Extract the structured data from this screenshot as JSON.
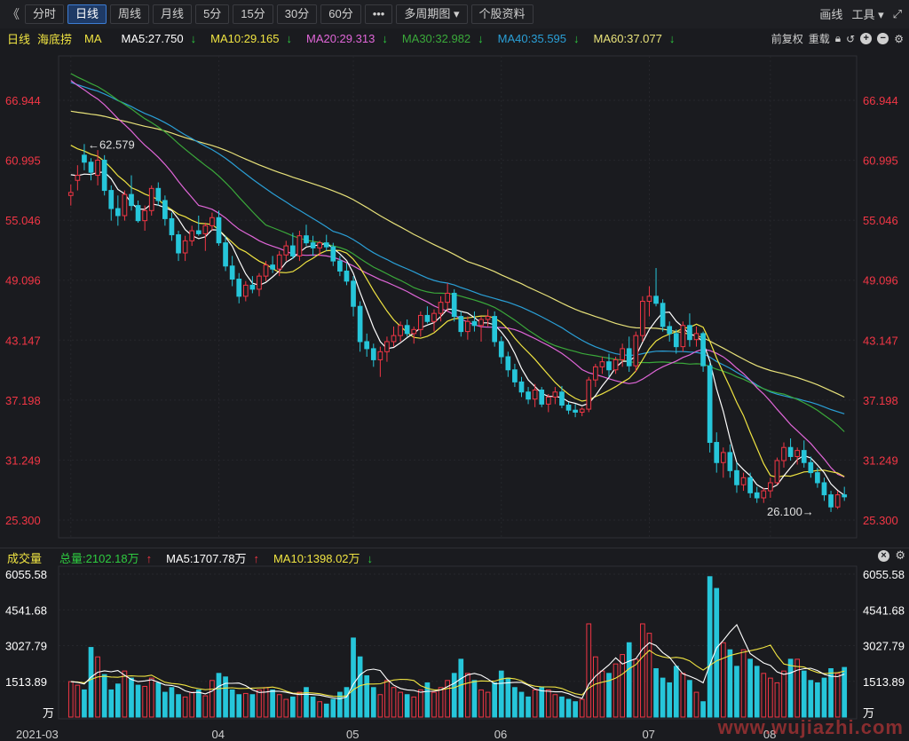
{
  "toolbar": {
    "collapse_icon": "《",
    "buttons": [
      "分时",
      "日线",
      "周线",
      "月线",
      "5分",
      "15分",
      "30分",
      "60分",
      "•••",
      "多周期图 ▾",
      "个股资料"
    ],
    "active_index": 1,
    "right": {
      "draw_label": "画线",
      "tools_label": "工具",
      "fullscreen_icon": "expand-icon"
    }
  },
  "ma_bar": {
    "period": "日线",
    "stock_name": "海底捞",
    "indicator": "MA",
    "ma5": "MA5:27.750",
    "ma10": "MA10:29.165",
    "ma20": "MA20:29.313",
    "ma30": "MA30:32.982",
    "ma40": "MA40:35.595",
    "ma60": "MA60:37.077",
    "down_arrow": "↓",
    "adjust_label": "前复权",
    "reset_label": "重载"
  },
  "volume_bar": {
    "title": "成交量",
    "total": "总量:2102.18万",
    "ma5": "MA5:1707.78万",
    "ma10": "MA10:1398.02万",
    "up_arrow": "↑",
    "down_arrow": "↓"
  },
  "colors": {
    "up": "#f23645",
    "down": "#26c6da",
    "ma5": "#ffffff",
    "ma10": "#f0e442",
    "ma20": "#e066d8",
    "ma30": "#3aa83a",
    "ma40": "#2a9fd6",
    "ma60": "#e8e27a",
    "axis_text": "#f23645",
    "vol_axis": "#ffffff"
  },
  "watermark": "www.wujiazhi.com",
  "chart_data": [
    {
      "type": "candlestick",
      "title": "海底捞 日线",
      "ylim": [
        25.3,
        70.0
      ],
      "y_ticks": [
        "66.944",
        "60.995",
        "55.046",
        "49.096",
        "43.147",
        "37.198",
        "31.249",
        "25.300"
      ],
      "x_ticks": [
        "2021-03",
        "04",
        "05",
        "06",
        "07",
        "08"
      ],
      "high_annotation": "62.579",
      "low_annotation": "26.100",
      "ohlc": [
        [
          57.5,
          58.6,
          56.5,
          57.8
        ],
        [
          59.0,
          60.5,
          58.0,
          59.5
        ],
        [
          61.5,
          62.6,
          60.0,
          60.8
        ],
        [
          60.8,
          61.2,
          59.0,
          59.8
        ],
        [
          59.5,
          62.0,
          58.5,
          61.0
        ],
        [
          61.0,
          61.5,
          57.5,
          58.0
        ],
        [
          58.0,
          58.5,
          55.0,
          56.2
        ],
        [
          56.2,
          57.5,
          54.5,
          55.5
        ],
        [
          55.5,
          58.0,
          55.0,
          57.6
        ],
        [
          57.6,
          59.5,
          56.0,
          56.5
        ],
        [
          56.5,
          57.0,
          54.8,
          55.0
        ],
        [
          55.0,
          56.5,
          54.0,
          56.0
        ],
        [
          56.0,
          58.5,
          55.5,
          58.2
        ],
        [
          58.2,
          58.8,
          56.5,
          57.0
        ],
        [
          57.0,
          57.5,
          54.5,
          55.2
        ],
        [
          55.2,
          55.8,
          53.0,
          53.6
        ],
        [
          53.6,
          54.0,
          51.0,
          51.8
        ],
        [
          51.8,
          53.5,
          51.0,
          53.0
        ],
        [
          53.0,
          54.5,
          52.5,
          54.0
        ],
        [
          54.0,
          55.5,
          53.5,
          53.7
        ],
        [
          53.7,
          54.8,
          52.0,
          54.5
        ],
        [
          54.5,
          55.8,
          54.0,
          55.3
        ],
        [
          55.3,
          56.0,
          52.5,
          52.8
        ],
        [
          52.8,
          53.5,
          50.0,
          50.5
        ],
        [
          50.5,
          51.5,
          48.5,
          49.2
        ],
        [
          49.2,
          49.8,
          46.8,
          47.5
        ],
        [
          47.5,
          49.0,
          47.0,
          48.6
        ],
        [
          48.6,
          49.5,
          47.8,
          48.2
        ],
        [
          48.2,
          49.8,
          47.5,
          49.5
        ],
        [
          49.5,
          51.0,
          49.0,
          50.6
        ],
        [
          50.6,
          51.5,
          49.8,
          50.2
        ],
        [
          50.2,
          52.0,
          49.5,
          51.6
        ],
        [
          51.6,
          53.0,
          51.0,
          52.5
        ],
        [
          52.5,
          53.8,
          51.2,
          51.5
        ],
        [
          51.5,
          54.0,
          51.0,
          53.5
        ],
        [
          53.5,
          54.6,
          52.5,
          52.8
        ],
        [
          52.8,
          53.5,
          51.5,
          52.3
        ],
        [
          52.3,
          53.0,
          51.5,
          52.8
        ],
        [
          52.8,
          53.6,
          52.0,
          52.4
        ],
        [
          52.4,
          52.8,
          50.5,
          51.0
        ],
        [
          51.0,
          51.5,
          49.5,
          50.0
        ],
        [
          50.0,
          50.8,
          48.6,
          49.0
        ],
        [
          49.0,
          49.5,
          45.5,
          46.5
        ],
        [
          46.5,
          47.0,
          42.0,
          43.0
        ],
        [
          43.0,
          43.8,
          41.5,
          42.3
        ],
        [
          42.3,
          42.8,
          40.5,
          41.2
        ],
        [
          41.2,
          42.5,
          39.5,
          42.0
        ],
        [
          42.0,
          43.5,
          41.0,
          43.0
        ],
        [
          43.0,
          44.5,
          42.5,
          43.6
        ],
        [
          43.6,
          45.0,
          43.0,
          44.6
        ],
        [
          44.6,
          45.2,
          43.5,
          43.8
        ],
        [
          43.8,
          44.5,
          42.8,
          44.2
        ],
        [
          44.2,
          46.0,
          43.5,
          45.6
        ],
        [
          45.6,
          46.5,
          44.8,
          45.0
        ],
        [
          45.0,
          46.2,
          44.0,
          45.8
        ],
        [
          45.8,
          47.5,
          45.0,
          46.9
        ],
        [
          46.9,
          48.8,
          46.0,
          47.8
        ],
        [
          47.8,
          48.2,
          45.0,
          45.5
        ],
        [
          45.5,
          46.0,
          43.5,
          44.0
        ],
        [
          44.0,
          45.5,
          43.2,
          45.0
        ],
        [
          45.0,
          46.0,
          44.0,
          44.6
        ],
        [
          44.6,
          45.5,
          43.0,
          45.2
        ],
        [
          45.2,
          46.2,
          44.5,
          45.5
        ],
        [
          45.5,
          46.0,
          42.5,
          43.0
        ],
        [
          43.0,
          43.5,
          40.8,
          41.5
        ],
        [
          41.5,
          42.0,
          39.5,
          40.2
        ],
        [
          40.2,
          40.8,
          38.5,
          39.0
        ],
        [
          39.0,
          39.5,
          37.5,
          38.0
        ],
        [
          38.0,
          38.5,
          36.8,
          37.3
        ],
        [
          37.3,
          38.8,
          36.5,
          38.2
        ],
        [
          38.2,
          38.5,
          36.5,
          36.8
        ],
        [
          36.8,
          37.8,
          36.0,
          37.5
        ],
        [
          37.5,
          38.5,
          36.8,
          38.0
        ],
        [
          38.0,
          38.6,
          36.4,
          36.7
        ],
        [
          36.7,
          37.0,
          35.8,
          36.2
        ],
        [
          36.2,
          36.8,
          35.5,
          36.0
        ],
        [
          36.0,
          36.5,
          35.6,
          36.3
        ],
        [
          36.3,
          39.5,
          36.0,
          39.2
        ],
        [
          39.2,
          40.8,
          38.5,
          40.5
        ],
        [
          40.5,
          41.5,
          39.8,
          41.0
        ],
        [
          41.0,
          41.8,
          39.5,
          40.2
        ],
        [
          40.2,
          41.5,
          39.8,
          41.2
        ],
        [
          41.2,
          42.8,
          40.5,
          42.3
        ],
        [
          42.3,
          43.5,
          40.0,
          40.6
        ],
        [
          40.6,
          44.0,
          40.0,
          43.6
        ],
        [
          43.6,
          47.5,
          43.0,
          47.0
        ],
        [
          47.0,
          48.5,
          45.5,
          47.5
        ],
        [
          47.5,
          50.3,
          46.5,
          46.8
        ],
        [
          46.8,
          47.2,
          44.0,
          44.5
        ],
        [
          44.5,
          45.0,
          43.0,
          43.8
        ],
        [
          43.8,
          44.2,
          41.8,
          42.5
        ],
        [
          42.5,
          45.0,
          42.0,
          44.6
        ],
        [
          44.6,
          45.8,
          42.5,
          43.2
        ],
        [
          43.2,
          44.5,
          42.5,
          43.8
        ],
        [
          43.8,
          44.0,
          40.0,
          40.6
        ],
        [
          40.6,
          41.0,
          32.0,
          33.0
        ],
        [
          33.0,
          34.0,
          30.0,
          31.0
        ],
        [
          31.0,
          32.5,
          29.5,
          32.0
        ],
        [
          32.0,
          32.8,
          29.5,
          30.2
        ],
        [
          30.2,
          31.0,
          28.0,
          28.8
        ],
        [
          28.8,
          30.0,
          28.2,
          29.5
        ],
        [
          29.5,
          30.0,
          27.5,
          28.0
        ],
        [
          28.0,
          28.6,
          27.0,
          27.5
        ],
        [
          27.5,
          28.5,
          27.0,
          28.2
        ],
        [
          28.2,
          29.5,
          27.5,
          29.0
        ],
        [
          29.0,
          31.5,
          28.8,
          31.2
        ],
        [
          31.2,
          33.0,
          30.5,
          32.5
        ],
        [
          32.5,
          33.4,
          31.2,
          31.6
        ],
        [
          31.6,
          32.5,
          30.8,
          32.2
        ],
        [
          32.2,
          33.2,
          30.5,
          31.0
        ],
        [
          31.0,
          31.6,
          29.5,
          30.0
        ],
        [
          30.0,
          30.5,
          28.5,
          29.0
        ],
        [
          29.0,
          29.5,
          27.2,
          27.8
        ],
        [
          27.8,
          28.2,
          26.1,
          26.6
        ],
        [
          26.6,
          28.2,
          26.4,
          27.8
        ],
        [
          27.8,
          28.6,
          27.2,
          27.6
        ]
      ],
      "ma5_last": 27.75,
      "ma10_last": 29.165,
      "ma20_last": 29.313,
      "ma30_last": 32.982,
      "ma40_last": 35.595,
      "ma60_last": 37.077
    },
    {
      "type": "bar",
      "title": "成交量",
      "unit": "万",
      "ylim": [
        0,
        6055.58
      ],
      "y_ticks": [
        "6055.58",
        "4541.68",
        "3027.79",
        "1513.89"
      ],
      "values": [
        1500,
        1350,
        1150,
        2950,
        2550,
        1800,
        1150,
        1400,
        1950,
        1650,
        1350,
        1300,
        1650,
        1450,
        1050,
        1250,
        950,
        850,
        1050,
        1150,
        900,
        1550,
        1850,
        1700,
        1150,
        950,
        1000,
        950,
        1150,
        1250,
        1150,
        950,
        750,
        850,
        1050,
        1250,
        850,
        650,
        550,
        750,
        1050,
        1250,
        3350,
        2550,
        1750,
        1250,
        950,
        1550,
        1250,
        1050,
        950,
        850,
        1150,
        1450,
        1050,
        1250,
        1550,
        1850,
        2450,
        1850,
        1550,
        1150,
        1050,
        1450,
        1950,
        1650,
        1250,
        1050,
        850,
        1150,
        1250,
        1150,
        950,
        850,
        750,
        650,
        750,
        3950,
        2550,
        1950,
        1850,
        2250,
        2650,
        3150,
        2450,
        3950,
        3550,
        2050,
        1650,
        1450,
        2150,
        1850,
        1550,
        1050,
        650,
        5950,
        5450,
        3150,
        2850,
        2150,
        2850,
        2450,
        2150,
        1850,
        1650,
        1450,
        1950,
        2450,
        2450,
        1950,
        1550,
        1450,
        1650,
        2050,
        1850,
        2102
      ]
    }
  ]
}
